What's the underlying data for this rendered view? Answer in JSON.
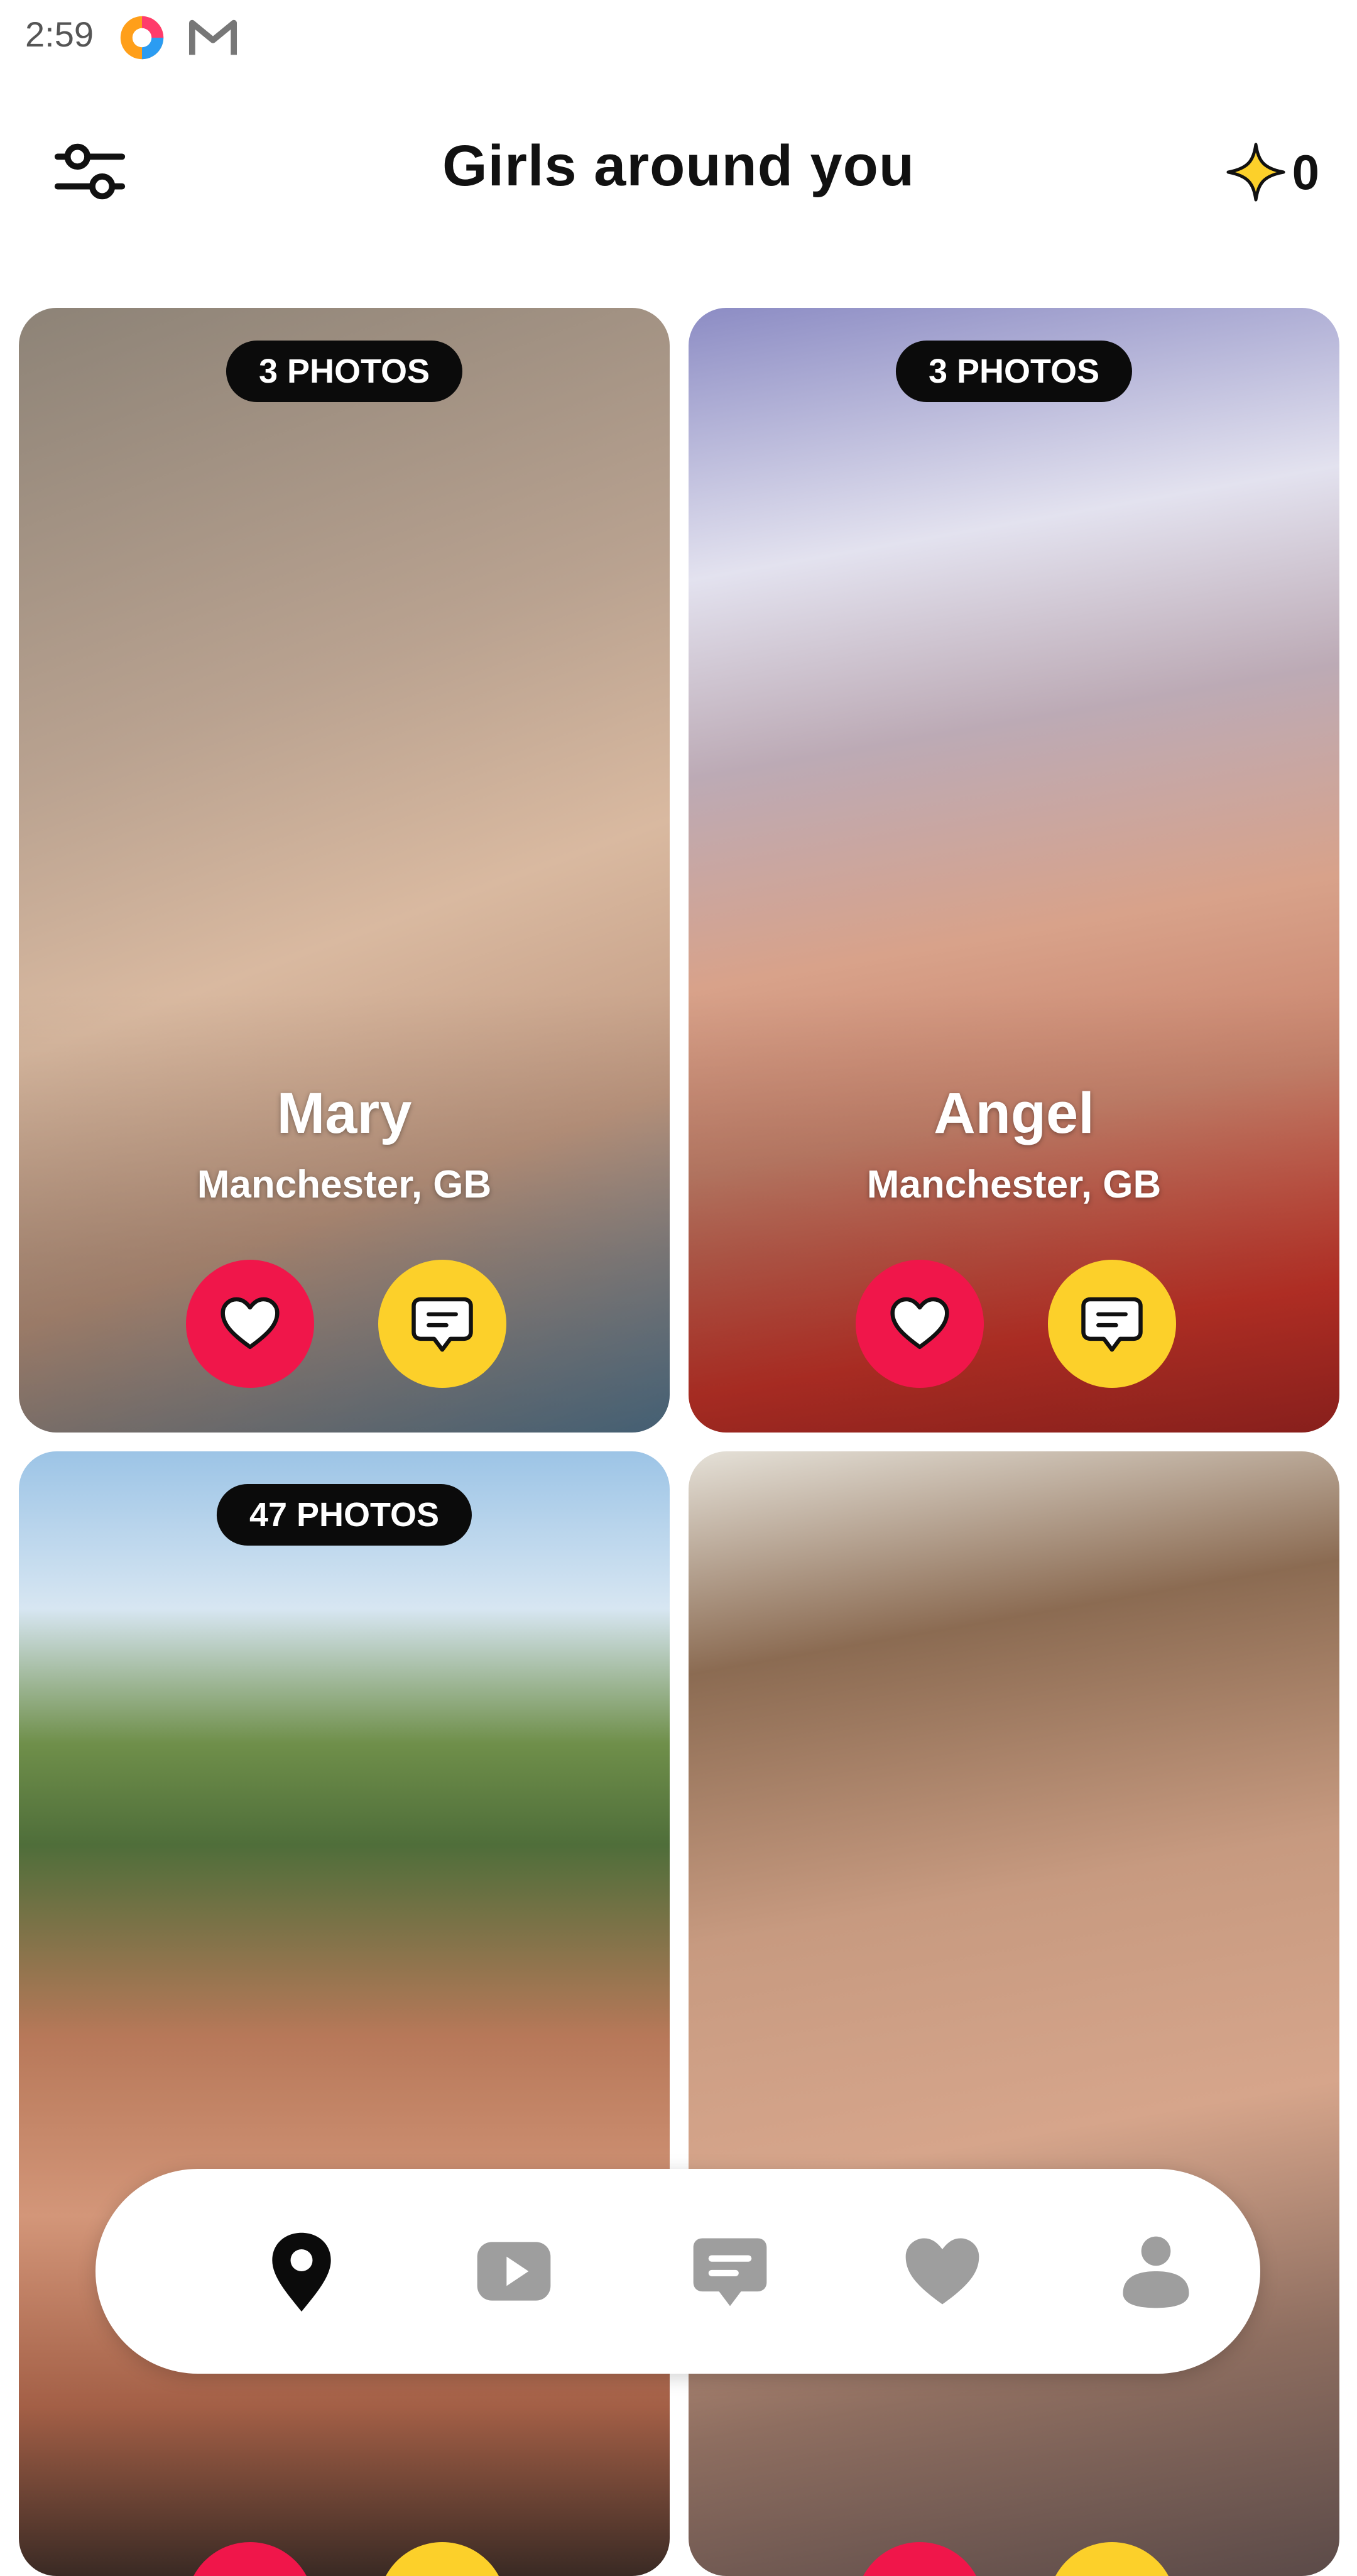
{
  "status_bar": {
    "time": "2:59",
    "icons": [
      "app-notification-icon",
      "gmail-icon"
    ]
  },
  "header": {
    "title": "Girls around you",
    "filter_icon": "sliders-icon",
    "credits_icon": "sparkle-icon",
    "credits": "0"
  },
  "profiles": [
    {
      "photos_label": "3 PHOTOS",
      "name": "Mary",
      "location": "Manchester, GB"
    },
    {
      "photos_label": "3 PHOTOS",
      "name": "Angel",
      "location": "Manchester, GB"
    },
    {
      "photos_label": "47 PHOTOS",
      "name": "",
      "location": ""
    },
    {
      "photos_label": "",
      "name": "",
      "location": ""
    }
  ],
  "actions": {
    "like_icon": "heart-icon",
    "chat_icon": "message-icon"
  },
  "colors": {
    "like": "#f0164a",
    "chat": "#fcd02a",
    "nav_active": "#0b0b0b",
    "nav_inactive": "#9e9e9e"
  },
  "bottom_nav": {
    "items": [
      {
        "icon": "location-pin-icon",
        "active": true
      },
      {
        "icon": "video-play-icon",
        "active": false
      },
      {
        "icon": "chat-bubble-icon",
        "active": false
      },
      {
        "icon": "heart-icon",
        "active": false
      },
      {
        "icon": "profile-icon",
        "active": false
      }
    ]
  }
}
